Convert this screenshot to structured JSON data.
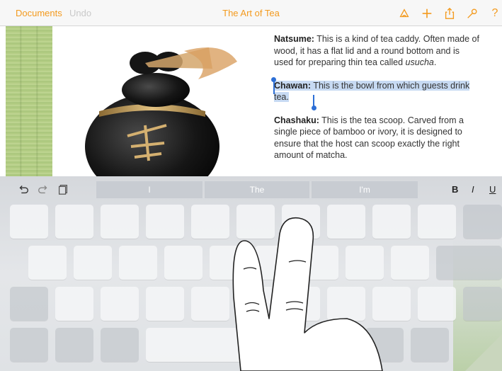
{
  "toolbar": {
    "documents_label": "Documents",
    "undo_label": "Undo",
    "title": "The Art of Tea",
    "icons": [
      "format-brush-icon",
      "add-icon",
      "share-icon",
      "wrench-icon",
      "help-icon"
    ],
    "help_glyph": "?",
    "accent_color": "#f39a1e"
  },
  "document": {
    "paragraphs": [
      {
        "term": "Natsume:",
        "text_before": " This is a kind of tea caddy. Often made of wood, it has a flat lid and a round bottom and is used for preparing thin tea called ",
        "italic": "usucha",
        "text_after": "."
      },
      {
        "term": "Chawan:",
        "text": " This is the bowl from which guests drink tea.",
        "selected": true
      },
      {
        "term": "Chashaku:",
        "text": " This is the tea scoop. Carved from a single piece of bamboo or ivory, it is designed to ensure that the host can scoop exactly the right amount of matcha."
      }
    ],
    "selection_color": "#c7daf3"
  },
  "keyboard": {
    "shortcuts": [
      "undo-icon",
      "redo-icon",
      "paste-icon"
    ],
    "suggestions": [
      "I",
      "The",
      "I'm"
    ],
    "format": {
      "bold": "B",
      "italic": "I",
      "underline": "U"
    }
  }
}
